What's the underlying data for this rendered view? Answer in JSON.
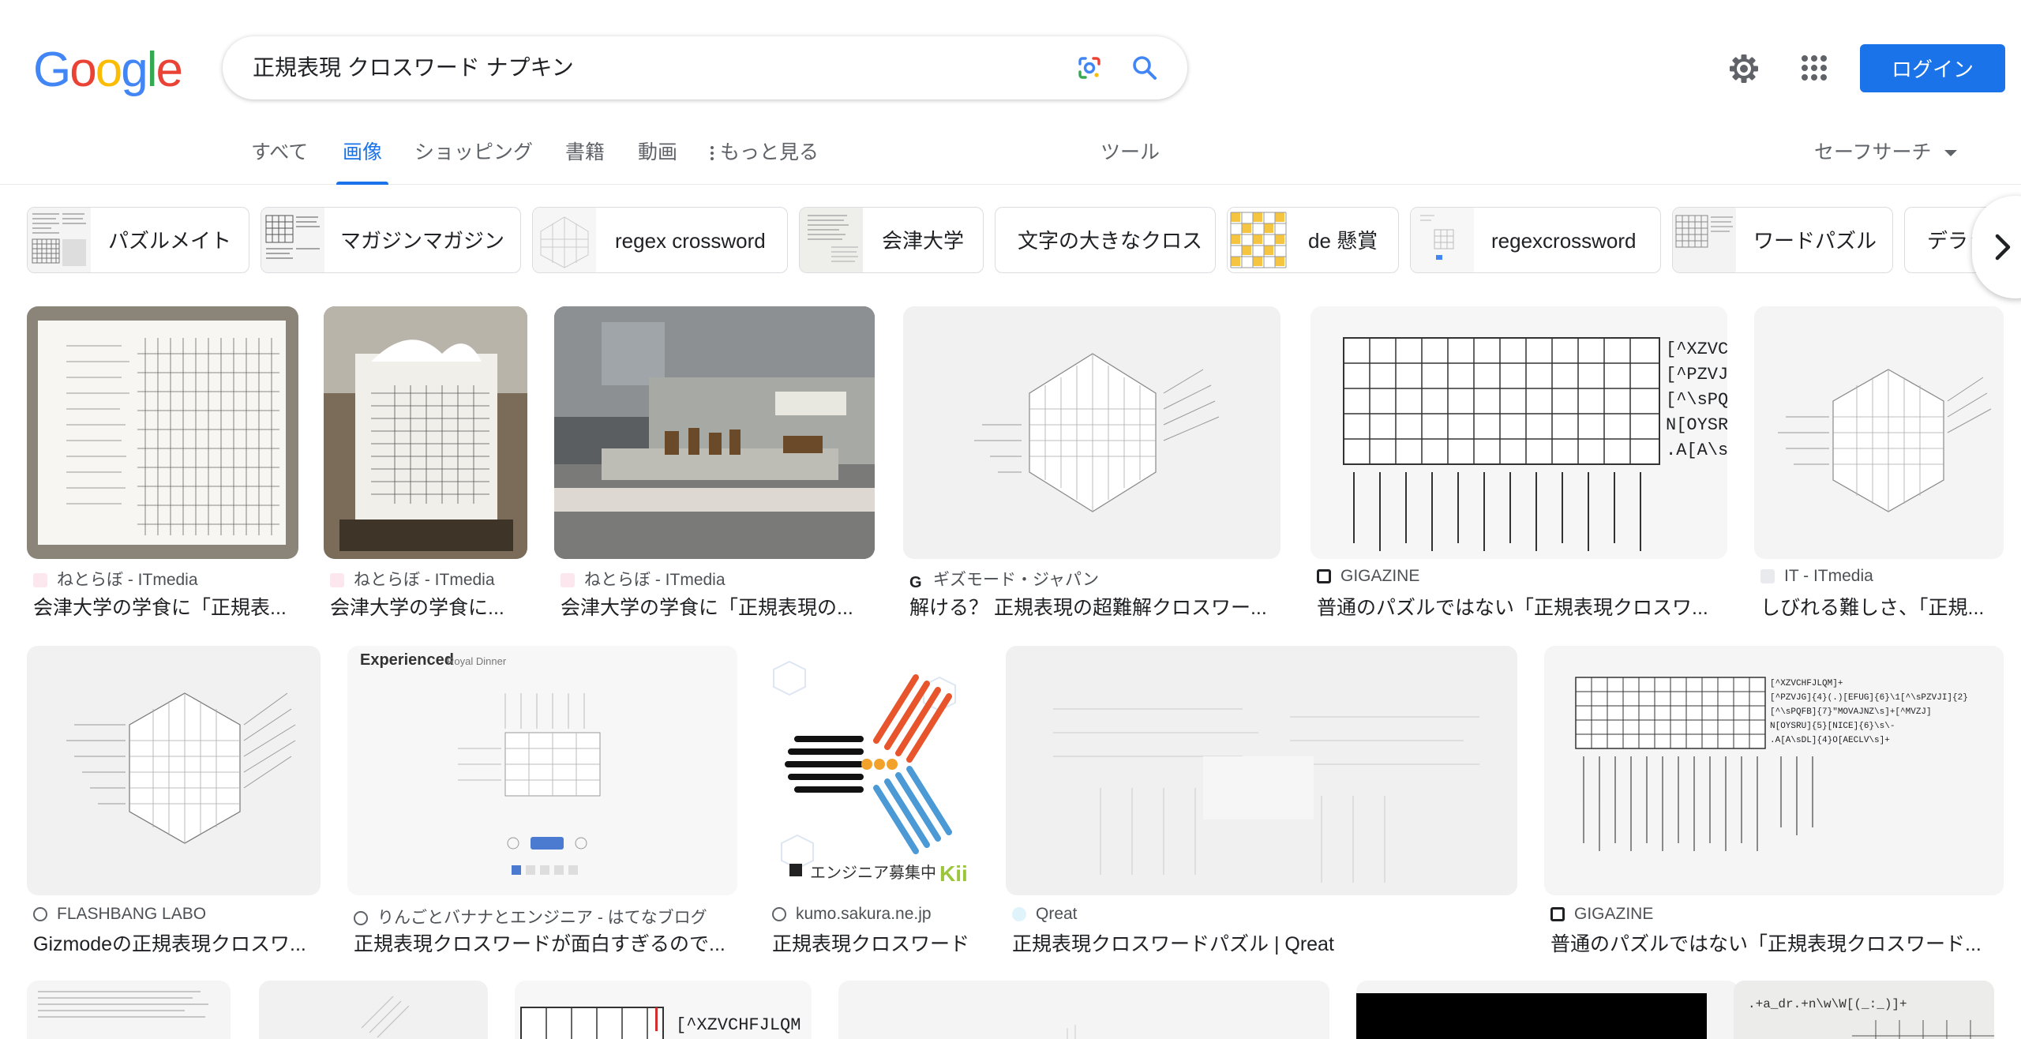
{
  "logo": [
    "G",
    "o",
    "o",
    "g",
    "l",
    "e"
  ],
  "search": {
    "query": "正規表現 クロスワード ナプキン"
  },
  "header": {
    "login_label": "ログイン"
  },
  "tabs": [
    {
      "label": "すべて",
      "active": false
    },
    {
      "label": "画像",
      "active": true
    },
    {
      "label": "ショッピング",
      "active": false
    },
    {
      "label": "書籍",
      "active": false
    },
    {
      "label": "動画",
      "active": false
    },
    {
      "label": "もっと見る",
      "active": false
    }
  ],
  "tools_label": "ツール",
  "safesearch_label": "セーフサーチ",
  "chips": [
    {
      "label": "パズルメイト"
    },
    {
      "label": "マガジンマガジン"
    },
    {
      "label": "regex crossword"
    },
    {
      "label": "会津大学"
    },
    {
      "label": "文字の大きなクロス"
    },
    {
      "label": "de 懸賞"
    },
    {
      "label": "regexcrossword"
    },
    {
      "label": "ワードパズル"
    },
    {
      "label": "デラッ"
    }
  ],
  "results": [
    {
      "source": "ねとらぼ - ITmedia",
      "title": "会津大学の学食に「正規表..."
    },
    {
      "source": "ねとらぼ - ITmedia",
      "title": "会津大学の学食に..."
    },
    {
      "source": "ねとらぼ - ITmedia",
      "title": "会津大学の学食に「正規表現の..."
    },
    {
      "source": "ギズモード・ジャパン",
      "title": "解ける？ 正規表現の超難解クロスワー..."
    },
    {
      "source": "GIGAZINE",
      "title": "普通のパズルではない「正規表現クロスワ..."
    },
    {
      "source": "IT - ITmedia",
      "title": "しびれる難しさ、「正規..."
    },
    {
      "source": "FLASHBANG LABO",
      "title": "Gizmodeの正規表現クロスワ..."
    },
    {
      "source": "りんごとバナナとエンジニア - はてなブログ",
      "title": "正規表現クロスワードが面白すぎるので..."
    },
    {
      "source": "kumo.sakura.ne.jp",
      "title": "正規表現クロスワード"
    },
    {
      "source": "Qreat",
      "title": "正規表現クロスワードパズル | Qreat"
    },
    {
      "source": "GIGAZINE",
      "title": "普通のパズルではない「正規表現クロスワード..."
    }
  ],
  "image_text": {
    "regex_rows": [
      "[^XZVCHF",
      "[^PZVJG]",
      "[^\\sPQFE",
      "N[OYSRU]",
      ".A[A\\sDL"
    ],
    "regex_rows_small": [
      "[^XZVCHFJLQM]+",
      "[^PZVJG]{4}(.)[EFUG]{6}\\1[^\\sPZVJI]{2}",
      "[^\\sPQFB]{7}\"MOVAJNZ\\s]+[^MVZJ]",
      "N[OYSRU]{5}[NICE]{6}\\s\\-",
      ".A[A\\sDL]{4}O[AECLV\\s]+"
    ],
    "experienced_title": "Experienced",
    "experienced_sub": "Royal Dinner",
    "kii_text": "エンジニア募集中",
    "kii_logo": "Kii",
    "bottom_regex": "[^XZVCHFJLQM",
    "bottom_napkin": ".+a_dr.+n\\w\\W[(_:_)]+"
  },
  "colors": {
    "accent": "#1a73e8",
    "text": "#202124",
    "muted": "#5f6368"
  }
}
